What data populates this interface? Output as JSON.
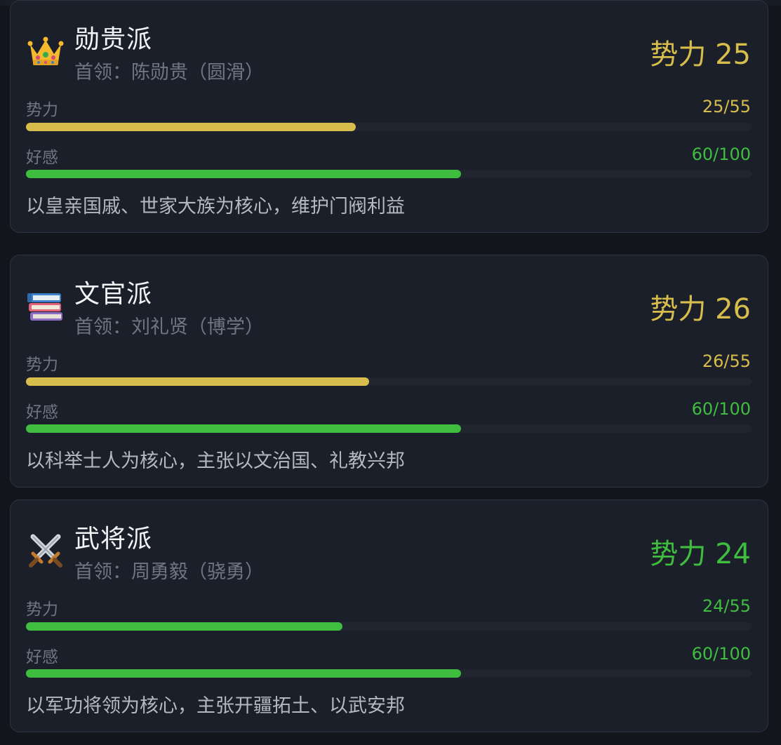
{
  "colors": {
    "gold": "#d6bd4c",
    "green": "#3ebd3e"
  },
  "factions": [
    {
      "icon": "books-icon",
      "name": "文官派",
      "leader": "首领：刘礼贤（博学）",
      "power_text": "势力 26",
      "power_color": "gold",
      "power_label": "势力",
      "power_value_text": "26/55",
      "power_value": 26,
      "power_max": 55,
      "favor_label": "好感",
      "favor_value_text": "60/100",
      "favor_value": 60,
      "favor_max": 100,
      "description": "以科举士人为核心，主张以文治国、礼教兴邦"
    },
    {
      "icon": "crossed-swords-icon",
      "name": "武将派",
      "leader": "首领：周勇毅（骁勇）",
      "power_text": "势力 24",
      "power_color": "green",
      "power_label": "势力",
      "power_value_text": "24/55",
      "power_value": 24,
      "power_max": 55,
      "favor_label": "好感",
      "favor_value_text": "60/100",
      "favor_value": 60,
      "favor_max": 100,
      "description": "以军功将领为核心，主张开疆拓土、以武安邦"
    },
    {
      "icon": "crown-icon",
      "name": "勋贵派",
      "leader": "首领：陈勋贵（圆滑）",
      "power_text": "势力 25",
      "power_color": "gold",
      "power_label": "势力",
      "power_value_text": "25/55",
      "power_value": 25,
      "power_max": 55,
      "favor_label": "好感",
      "favor_value_text": "60/100",
      "favor_value": 60,
      "favor_max": 100,
      "description": "以皇亲国戚、世家大族为核心，维护门阀利益"
    }
  ]
}
